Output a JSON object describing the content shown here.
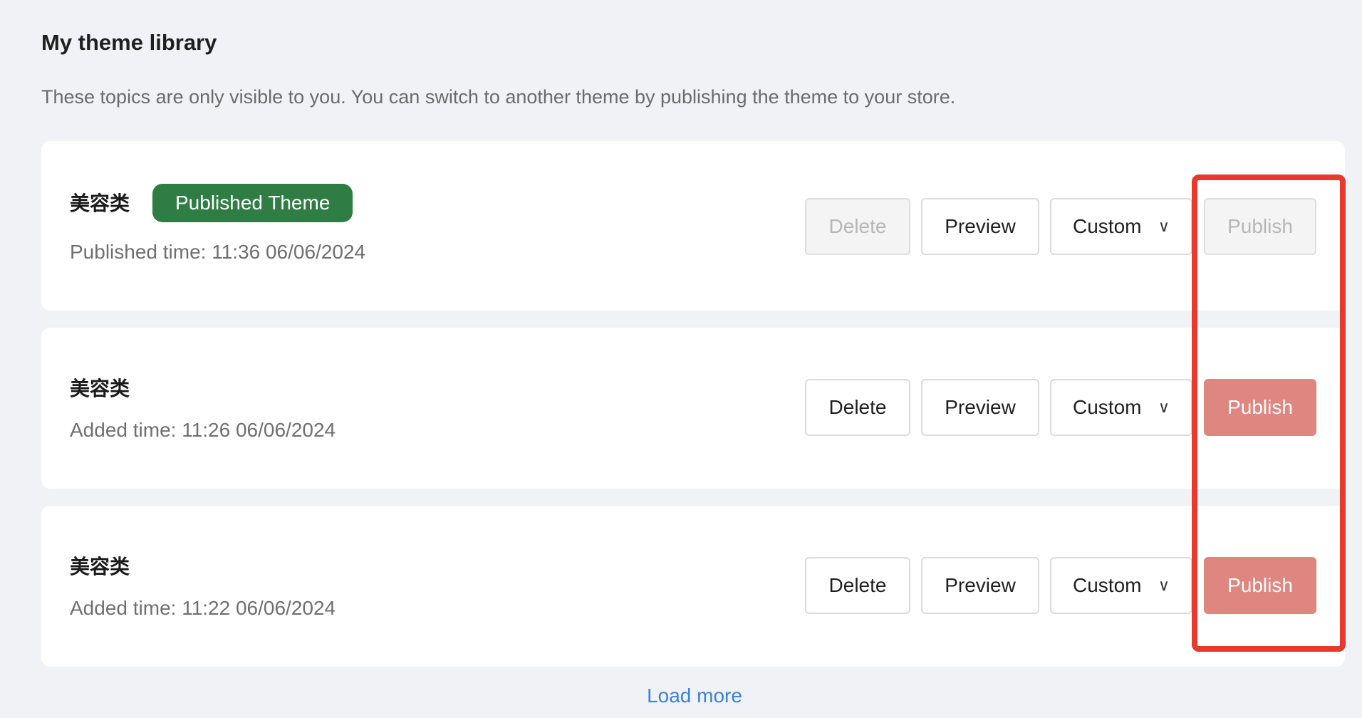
{
  "header": {
    "title": "My theme library",
    "description": "These topics are only visible to you. You can switch to another theme by publishing the theme to your store."
  },
  "themes": [
    {
      "name": "美容类",
      "badge": "Published Theme",
      "time_text": "Published time: 11:36 06/06/2024",
      "delete_label": "Delete",
      "preview_label": "Preview",
      "custom_label": "Custom",
      "publish_label": "Publish",
      "delete_disabled": true,
      "publish_disabled": true
    },
    {
      "name": "美容类",
      "time_text": "Added time: 11:26 06/06/2024",
      "delete_label": "Delete",
      "preview_label": "Preview",
      "custom_label": "Custom",
      "publish_label": "Publish",
      "delete_disabled": false,
      "publish_disabled": false
    },
    {
      "name": "美容类",
      "time_text": "Added time: 11:22 06/06/2024",
      "delete_label": "Delete",
      "preview_label": "Preview",
      "custom_label": "Custom",
      "publish_label": "Publish",
      "delete_disabled": false,
      "publish_disabled": false
    }
  ],
  "footer": {
    "load_more": "Load more"
  },
  "icons": {
    "custom_dropdown": "chevron-down-icon"
  },
  "colors": {
    "badge_bg": "#2f7d45",
    "publish_active": "#e08680",
    "highlight_border": "#e63a2e",
    "link": "#3b82d9"
  }
}
